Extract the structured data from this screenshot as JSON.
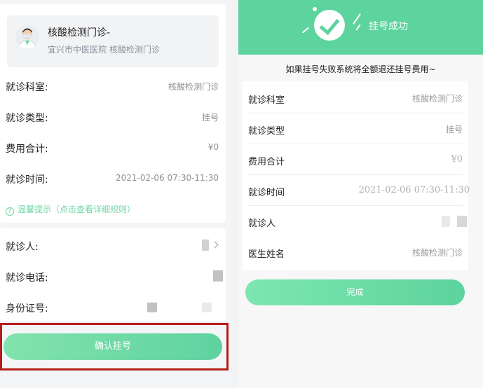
{
  "left": {
    "doctor": {
      "name": "核酸检测门诊-",
      "subtitle": "宜兴市中医医院 核酸检测门诊"
    },
    "rows": [
      {
        "label": "就诊科室:",
        "value": "核酸检测门诊"
      },
      {
        "label": "就诊类型:",
        "value": "挂号"
      },
      {
        "label": "费用合计:",
        "value": "¥0"
      },
      {
        "label": "就诊时间:",
        "value": "2021-02-06 07:30-11:30"
      }
    ],
    "tip": "温馨提示（点击查看详细规则）",
    "patient_rows": [
      {
        "label": "就诊人:"
      },
      {
        "label": "就诊电话:"
      },
      {
        "label": "身份证号:"
      }
    ],
    "confirm_button": "确认挂号"
  },
  "right": {
    "success_title": "挂号成功",
    "notice": "如果挂号失败系统将全额退还挂号费用~",
    "rows": [
      {
        "label": "就诊科室",
        "value": "核酸检测门诊"
      },
      {
        "label": "就诊类型",
        "value": "挂号"
      },
      {
        "label": "费用合计",
        "value": "¥0"
      },
      {
        "label": "就诊时间",
        "value": "2021-02-06 07:30-11:30"
      },
      {
        "label": "就诊人",
        "value": ""
      },
      {
        "label": "医生姓名",
        "value": "核酸检测门诊"
      }
    ],
    "done_button": "完成"
  },
  "colors": {
    "accent": "#5dd39d",
    "highlight_border": "#b31c1c"
  }
}
